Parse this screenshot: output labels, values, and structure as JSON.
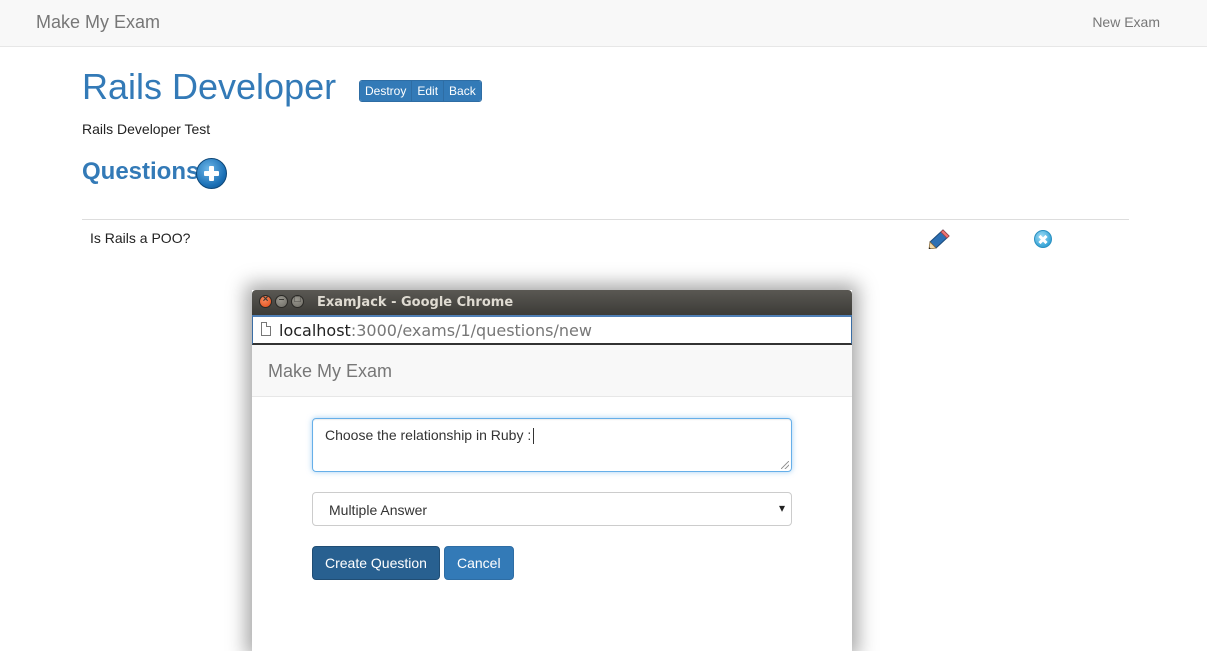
{
  "navbar": {
    "brand": "Make My Exam",
    "new_exam": "New Exam"
  },
  "exam": {
    "title": "Rails Developer",
    "actions": [
      "Destroy",
      "Edit",
      "Back"
    ],
    "description": "Rails Developer Test"
  },
  "questions": {
    "heading": "Questions",
    "rows": [
      {
        "text": "Is Rails a POO?"
      }
    ]
  },
  "popup": {
    "window_title": "ExamJack - Google Chrome",
    "url_host": "localhost",
    "url_path": ":3000/exams/1/questions/new",
    "brand": "Make My Exam",
    "question_value": "Choose the relationship in Ruby :",
    "select_value": "Multiple Answer",
    "create_label": "Create Question",
    "cancel_label": "Cancel",
    "window_buttons": {
      "close": "×",
      "min": "–",
      "max": "□"
    }
  },
  "icons": {
    "add": "plus-circle-icon",
    "edit": "pencil-icon",
    "delete": "x-circle-icon",
    "select_arrow": "▾"
  },
  "colors": {
    "primary": "#337ab7",
    "nav_bg": "#f8f8f8"
  }
}
